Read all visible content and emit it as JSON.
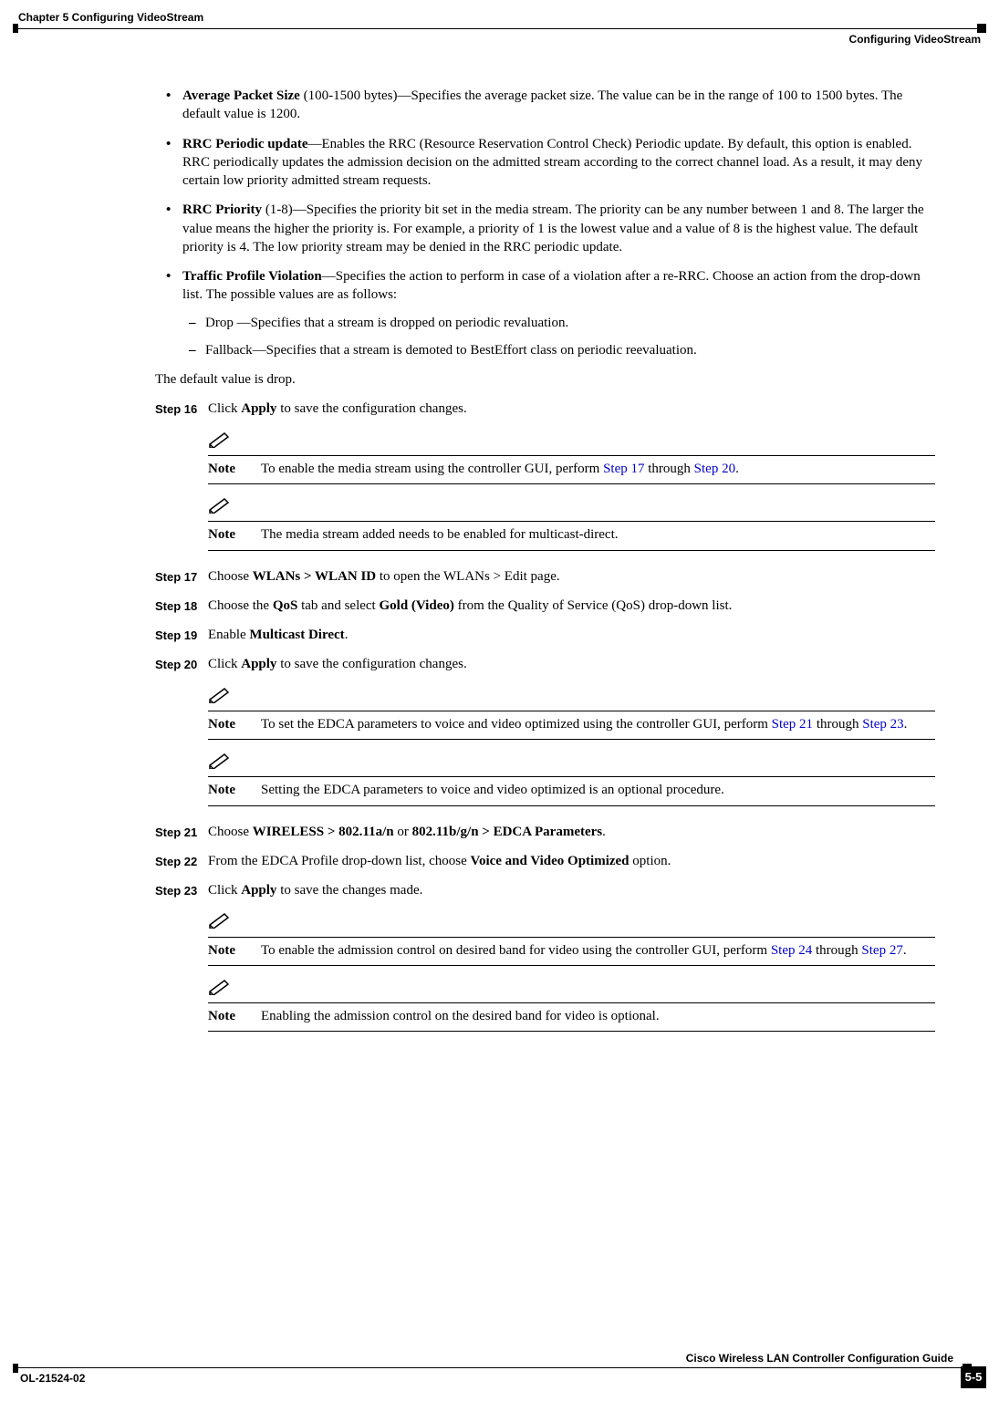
{
  "header": {
    "left": "Chapter 5      Configuring VideoStream",
    "right": "Configuring VideoStream"
  },
  "bullets": {
    "avg_packet_title": "Average Packet Size",
    "avg_packet_desc": " (100-1500 bytes)—Specifies the average packet size. The value can be in the range of 100 to 1500 bytes. The default value is 1200.",
    "rrc_periodic_title": "RRC Periodic update",
    "rrc_periodic_desc": "—Enables the RRC (Resource Reservation Control Check) Periodic update. By default, this option is enabled. RRC periodically updates the admission decision on the admitted stream according to the correct channel load. As a result, it may deny certain low priority admitted stream requests.",
    "rrc_priority_title": "RRC Priority",
    "rrc_priority_desc": " (1-8)—Specifies the priority bit set in the media stream. The priority can be any number between 1 and 8. The larger the value means the higher the priority is. For example, a priority of 1 is the lowest value and a value of 8 is the highest value. The default priority is 4. The low priority stream may be denied in the RRC periodic update.",
    "traffic_title": "Traffic Profile Violation",
    "traffic_desc": "—Specifies the action to perform in case of a violation after a re-RRC. Choose an action from the drop-down list. The possible values are as follows:",
    "sub_drop": "Drop —Specifies that a stream is dropped on periodic revaluation.",
    "sub_fallback": "Fallback—Specifies that a stream is demoted to BestEffort class on periodic reevaluation."
  },
  "default_value_drop": "The default value is drop.",
  "steps": {
    "s16_label": "Step 16",
    "s16_prefix": "Click ",
    "s16_bold": "Apply",
    "s16_suffix": " to save the configuration changes.",
    "s17_label": "Step 17",
    "s17_prefix": "Choose ",
    "s17_b1": "WLANs > WLAN ID",
    "s17_suffix": " to open the WLANs > Edit page.",
    "s18_label": "Step 18",
    "s18_prefix": "Choose the ",
    "s18_b1": "QoS",
    "s18_mid": " tab and select ",
    "s18_b2": "Gold (Video)",
    "s18_suffix": " from the Quality of Service (QoS) drop-down list.",
    "s19_label": "Step 19",
    "s19_prefix": "Enable ",
    "s19_b1": "Multicast Direct",
    "s19_suffix": ".",
    "s20_label": "Step 20",
    "s20_prefix": "Click ",
    "s20_b1": "Apply",
    "s20_suffix": " to save the configuration changes.",
    "s21_label": "Step 21",
    "s21_prefix": "Choose ",
    "s21_b1": "WIRELESS > 802.11a/n",
    "s21_mid": " or ",
    "s21_b2": "802.11b/g/n > EDCA Parameters",
    "s21_suffix": ".",
    "s22_label": "Step 22",
    "s22_prefix": "From the EDCA Profile drop-down list, choose ",
    "s22_b1": "Voice and Video Optimized",
    "s22_suffix": " option.",
    "s23_label": "Step 23",
    "s23_prefix": "Click ",
    "s23_b1": "Apply",
    "s23_suffix": " to save the changes made."
  },
  "notes": {
    "label": "Note",
    "n1_prefix": "To enable the media stream using the controller GUI, perform ",
    "n1_link1": "Step 17",
    "n1_mid": " through ",
    "n1_link2": "Step 20",
    "n1_suffix": ".",
    "n2": "The media stream added needs to be enabled for multicast-direct.",
    "n3_prefix": "To set the EDCA parameters to voice and video optimized using the controller GUI, perform ",
    "n3_link1": "Step 21",
    "n3_mid": " through ",
    "n3_link2": "Step 23",
    "n3_suffix": ".",
    "n4": "Setting the EDCA parameters to voice and video optimized is an optional procedure.",
    "n5_prefix": "To enable the admission control on desired band for video using the controller GUI, perform ",
    "n5_link1": "Step 24",
    "n5_mid": " through ",
    "n5_link2": "Step 27",
    "n5_suffix": ".",
    "n6": "Enabling the admission control on the desired band for video is optional."
  },
  "footer": {
    "guide": "Cisco Wireless LAN Controller Configuration Guide",
    "docnum": "OL-21524-02",
    "pagenum": "5-5"
  }
}
